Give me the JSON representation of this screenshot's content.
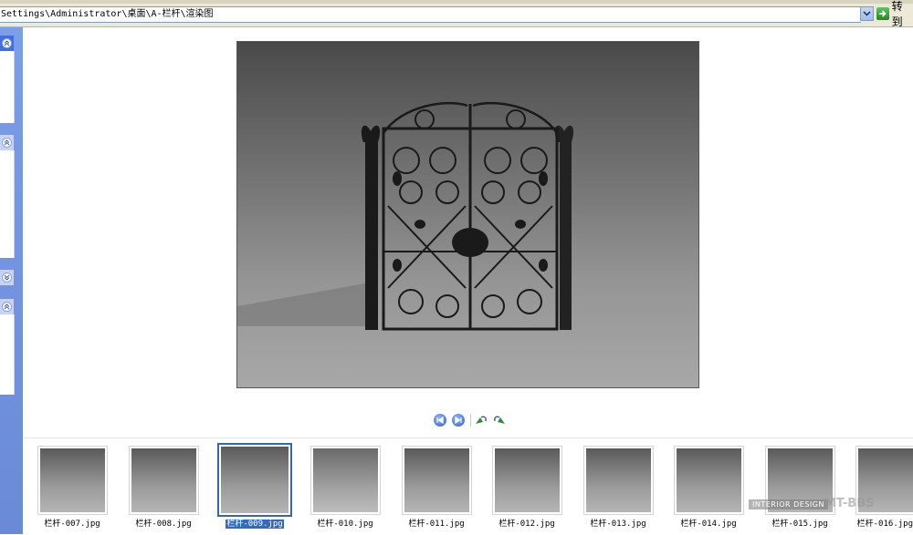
{
  "address_bar": {
    "path": "Settings\\Administrator\\桌面\\A-栏杆\\渲染图",
    "go_label": "转到"
  },
  "task_pane": {
    "panels": [
      {
        "chevron": "up"
      },
      {
        "chevron": "up"
      },
      {
        "chevron": "down"
      },
      {
        "chevron": "up"
      }
    ]
  },
  "viewer": {
    "toolbar": [
      {
        "name": "previous-image-button",
        "icon": "prev-icon"
      },
      {
        "name": "next-image-button",
        "icon": "next-icon"
      },
      {
        "name": "rotate-clockwise-button",
        "icon": "rotate-cw-icon"
      },
      {
        "name": "rotate-counterclockwise-button",
        "icon": "rotate-ccw-icon"
      }
    ]
  },
  "filmstrip": {
    "thumbnails": [
      {
        "label": "栏杆-007.jpg",
        "selected": false
      },
      {
        "label": "栏杆-008.jpg",
        "selected": false
      },
      {
        "label": "栏杆-009.jpg",
        "selected": true
      },
      {
        "label": "栏杆-010.jpg",
        "selected": false
      },
      {
        "label": "栏杆-011.jpg",
        "selected": false
      },
      {
        "label": "栏杆-012.jpg",
        "selected": false
      },
      {
        "label": "栏杆-013.jpg",
        "selected": false
      },
      {
        "label": "栏杆-014.jpg",
        "selected": false
      },
      {
        "label": "栏杆-015.jpg",
        "selected": false
      },
      {
        "label": "栏杆-016.jpg",
        "selected": false
      }
    ],
    "watermark": "INTERIOR DESIGN",
    "watermark_brand": "MT-BBS"
  },
  "colors": {
    "selection": "#316ac5",
    "selected_border": "#3467b0",
    "task_pane": "#6a8ad8"
  }
}
